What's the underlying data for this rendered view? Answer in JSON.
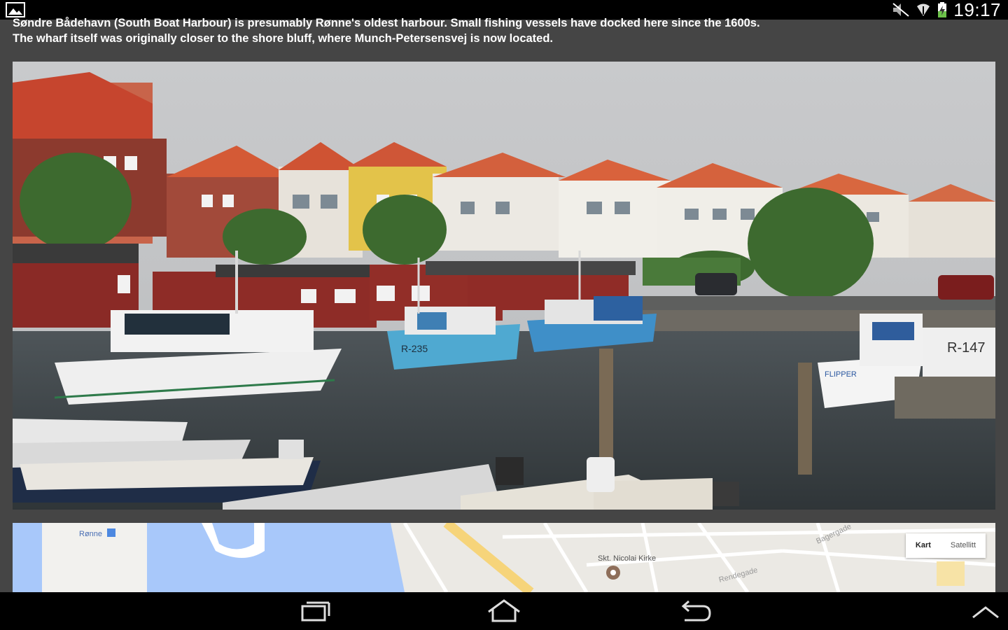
{
  "status_bar": {
    "time": "19:17"
  },
  "description": {
    "line1": "Søndre Bådehavn (South Boat Harbour) is presumably Rønne's oldest harbour. Small fishing vessels have docked here since the 1600s.",
    "line2": "The wharf itself was originally closer to the shore bluff, where Munch-Petersensvej is now located."
  },
  "map": {
    "place_label_1": "Rønne",
    "place_label_2": "Skt. Nicolai Kirke",
    "street_label_1": "Bagergade",
    "street_label_2": "Rendegade",
    "map_button": "Kart",
    "satellite_button": "Satellitt"
  },
  "photo": {
    "boat_label_1": "R-235",
    "boat_label_2": "R-147",
    "boat_label_3": "FLIPPER"
  },
  "colors": {
    "background": "#454545",
    "system_bar": "#000000",
    "water_on_map": "#a8c8fa"
  }
}
